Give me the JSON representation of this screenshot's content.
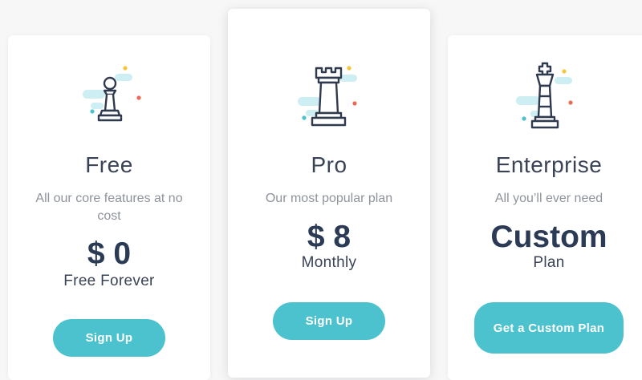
{
  "plans": [
    {
      "name": "Free",
      "description": "All our core features at no cost",
      "price": "$ 0",
      "price_note": "Free Forever",
      "button": "Sign Up",
      "icon": "chess-pawn-icon"
    },
    {
      "name": "Pro",
      "description": "Our most popular plan",
      "price": "$ 8",
      "price_note": "Monthly",
      "button": "Sign Up",
      "icon": "chess-rook-icon"
    },
    {
      "name": "Enterprise",
      "description": "All you’ll ever need",
      "price": "Custom",
      "price_note": "Plan",
      "button": "Get a Custom Plan",
      "icon": "chess-king-icon"
    }
  ],
  "colors": {
    "accent": "#4cc2cf",
    "heading": "#2b3a55",
    "muted": "#8e939c",
    "icon_stroke": "#2f3a4f",
    "cloud": "#cdeef2",
    "dot_yellow": "#f5c53a",
    "dot_red": "#ec6a55",
    "dot_teal": "#4cc2cf"
  }
}
